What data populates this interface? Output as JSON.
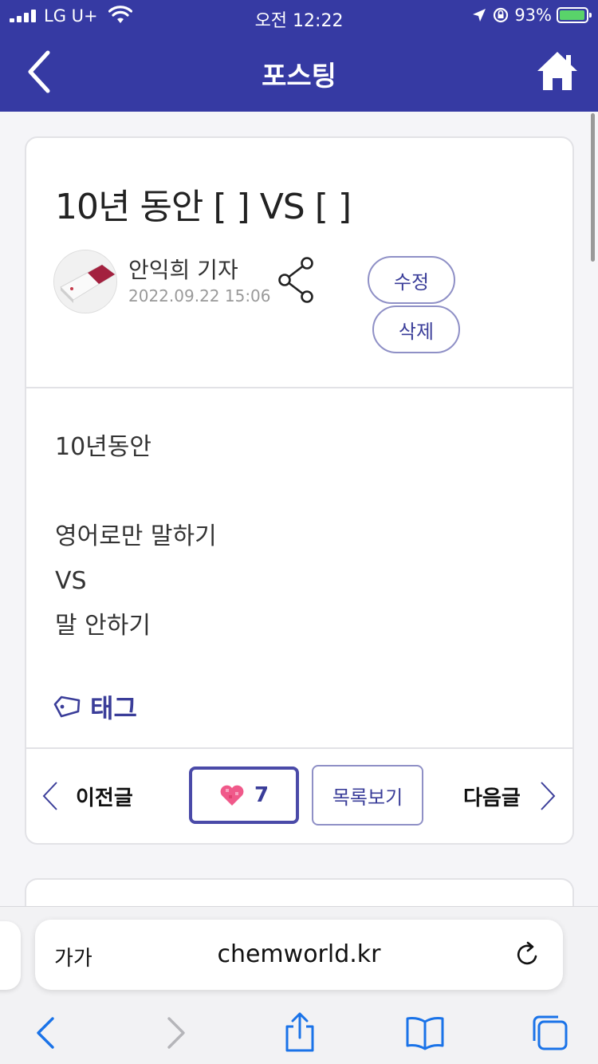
{
  "status_bar": {
    "carrier": "LG U+",
    "time": "오전 12:22",
    "battery": "93%"
  },
  "header": {
    "title": "포스팅"
  },
  "post": {
    "title": "10년 동안 [ ] VS [ ]",
    "author": "안익희 기자",
    "date": "2022.09.22 15:06",
    "edit_label": "수정",
    "delete_label": "삭제",
    "body_lines": [
      "10년동안",
      "",
      "영어로만 말하기",
      "VS",
      "말 안하기"
    ],
    "tag_label": "태그"
  },
  "post_nav": {
    "prev_label": "이전글",
    "like_count": "7",
    "list_label": "목록보기",
    "next_label": "다음글"
  },
  "browser": {
    "text_size_label": "가가",
    "url": "chemworld.kr"
  },
  "colors": {
    "header_bg": "#363aa3",
    "accent": "#3a3d99",
    "heart": "#f0598a"
  }
}
